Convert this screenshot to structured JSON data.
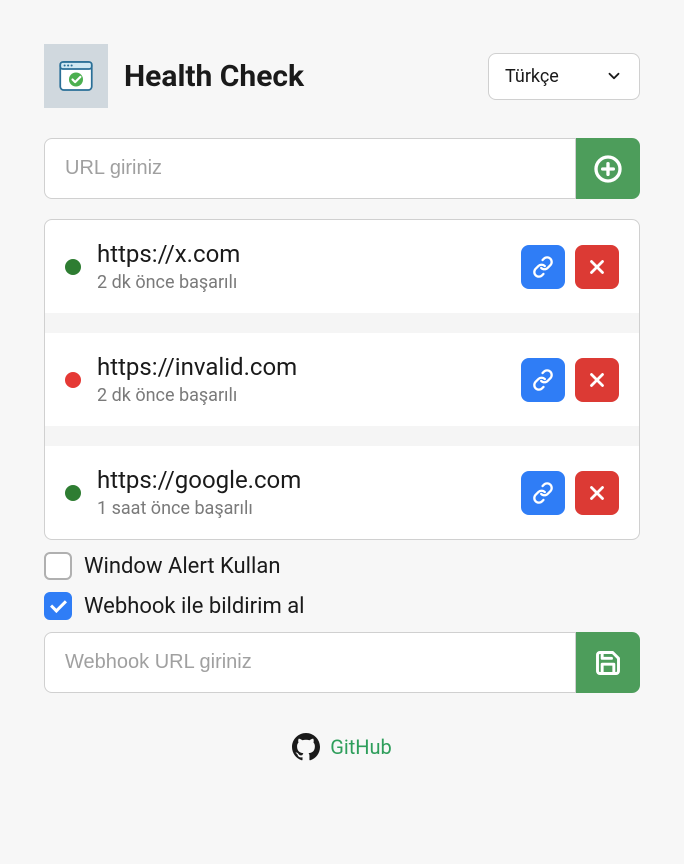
{
  "header": {
    "title": "Health Check",
    "language": "Türkçe"
  },
  "urlInput": {
    "placeholder": "URL giriniz"
  },
  "items": [
    {
      "url": "https://x.com",
      "status": "2 dk önce başarılı",
      "dot": "green"
    },
    {
      "url": "https://invalid.com",
      "status": "2 dk önce başarılı",
      "dot": "red"
    },
    {
      "url": "https://google.com",
      "status": "1 saat önce başarılı",
      "dot": "green"
    }
  ],
  "settings": {
    "windowAlert": {
      "label": "Window Alert Kullan",
      "checked": false
    },
    "webhook": {
      "label": "Webhook ile bildirim al",
      "checked": true
    },
    "webhookPlaceholder": "Webhook URL giriniz"
  },
  "footer": {
    "github": "GitHub"
  }
}
